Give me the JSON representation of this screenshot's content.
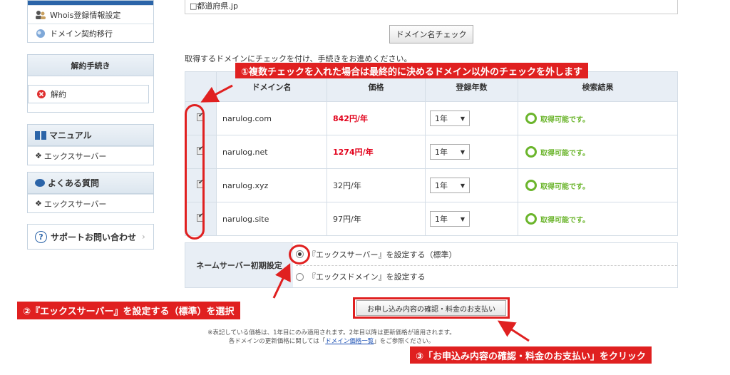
{
  "sidebar": {
    "top_items": [
      {
        "label": "Whois登録情報設定",
        "icon": "users-icon"
      },
      {
        "label": "ドメイン契約移行",
        "icon": "transfer-icon"
      }
    ],
    "cancel_head": "解約手続き",
    "cancel_item": "解約",
    "manual_head": "マニュアル",
    "manual_item": "エックスサーバー",
    "faq_head": "よくある質問",
    "faq_item": "エックスサーバー",
    "support": "サポートお問い合わせ"
  },
  "main": {
    "top_field": "□都道府県.jp",
    "check_button": "ドメイン名チェック",
    "instruction": "取得するドメインにチェックを付け、手続きをお進めください。",
    "columns": [
      "ドメイン名",
      "価格",
      "登録年数",
      "検索結果"
    ],
    "rows": [
      {
        "domain": "narulog.com",
        "price": "842円/年",
        "years": "1年",
        "result": "取得可能です。",
        "highlight": true
      },
      {
        "domain": "narulog.net",
        "price": "1274円/年",
        "years": "1年",
        "result": "取得可能です。",
        "highlight": true
      },
      {
        "domain": "narulog.xyz",
        "price": "32円/年",
        "years": "1年",
        "result": "取得可能です。",
        "highlight": false
      },
      {
        "domain": "narulog.site",
        "price": "97円/年",
        "years": "1年",
        "result": "取得可能です。",
        "highlight": false
      }
    ],
    "ns_label": "ネームサーバー初期設定",
    "ns_options": [
      "『エックスサーバー』を設定する（標準）",
      "『エックスドメイン』を設定する"
    ],
    "confirm_button": "お申し込み内容の確認・料金のお支払い",
    "note_line1": "※表記している価格は、1年目にのみ適用されます。2年目以降は更新価格が適用されます。",
    "note_line2_pre": "各ドメインの更新価格に関しては「",
    "note_link": "ドメイン価格一覧",
    "note_line2_post": "」をご参照ください。"
  },
  "annotations": {
    "a1": "①複数チェックを入れた場合は最終的に決めるドメイン以外のチェックを外します",
    "a2": "②『エックスサーバー』を設定する（標準）を選択",
    "a3": "③「お申込み内容の確認・料金のお支払い」をクリック"
  },
  "colors": {
    "accent": "#e02020",
    "available": "#6bb52c",
    "price_red": "#e2001a",
    "nav_blue": "#2b64a8"
  }
}
